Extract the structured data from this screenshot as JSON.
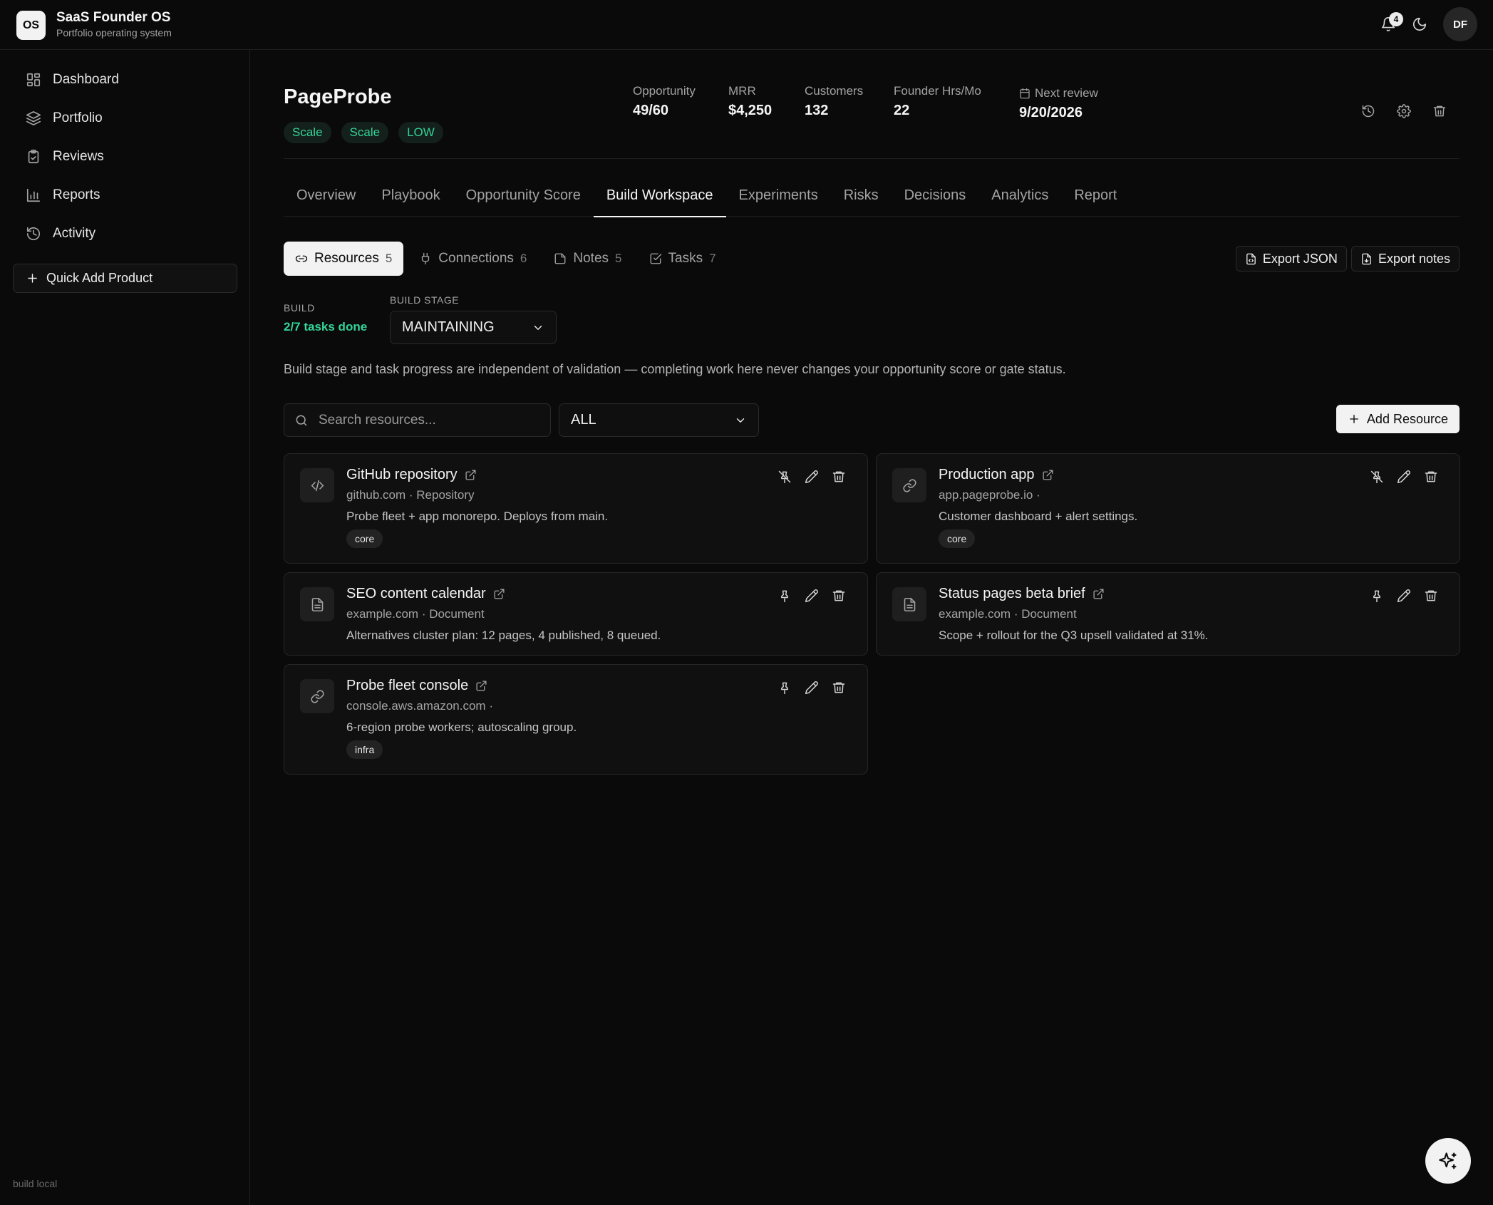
{
  "app": {
    "logo": "OS",
    "title": "SaaS Founder OS",
    "subtitle": "Portfolio operating system",
    "notification_count": "4",
    "avatar_initials": "DF"
  },
  "sidebar": {
    "items": [
      {
        "label": "Dashboard",
        "icon": "dashboard-icon"
      },
      {
        "label": "Portfolio",
        "icon": "layers-icon"
      },
      {
        "label": "Reviews",
        "icon": "clipboard-icon"
      },
      {
        "label": "Reports",
        "icon": "bar-chart-icon"
      },
      {
        "label": "Activity",
        "icon": "history-icon"
      }
    ],
    "quick_add": "Quick Add Product",
    "footer": "build local"
  },
  "product": {
    "name": "PageProbe",
    "pills": [
      "Scale",
      "Scale",
      "LOW"
    ],
    "stats": [
      {
        "label": "Opportunity",
        "value": "49/60"
      },
      {
        "label": "MRR",
        "value": "$4,250"
      },
      {
        "label": "Customers",
        "value": "132"
      },
      {
        "label": "Founder Hrs/Mo",
        "value": "22"
      },
      {
        "label": "Next review",
        "value": "9/20/2026"
      }
    ]
  },
  "tabs": [
    "Overview",
    "Playbook",
    "Opportunity Score",
    "Build Workspace",
    "Experiments",
    "Risks",
    "Decisions",
    "Analytics",
    "Report"
  ],
  "active_tab": "Build Workspace",
  "subtabs": [
    {
      "label": "Resources",
      "count": "5"
    },
    {
      "label": "Connections",
      "count": "6"
    },
    {
      "label": "Notes",
      "count": "5"
    },
    {
      "label": "Tasks",
      "count": "7"
    }
  ],
  "export": {
    "json": "Export JSON",
    "notes": "Export notes"
  },
  "build": {
    "label": "BUILD",
    "value": "2/7 tasks done",
    "stage_label": "BUILD STAGE",
    "stage_value": "MAINTAINING"
  },
  "info_text": "Build stage and task progress are independent of validation — completing work here never changes your opportunity score or gate status.",
  "search": {
    "placeholder": "Search resources..."
  },
  "filter": {
    "value": "ALL"
  },
  "add_resource": "Add Resource",
  "resources": [
    {
      "title": "GitHub repository",
      "meta": "github.com · Repository",
      "desc": "Probe fleet + app monorepo. Deploys from main.",
      "tag": "core",
      "icon": "code-icon",
      "pinned": true
    },
    {
      "title": "Production app",
      "meta": "app.pageprobe.io ·",
      "desc": "Customer dashboard + alert settings.",
      "tag": "core",
      "icon": "link-icon",
      "pinned": true
    },
    {
      "title": "SEO content calendar",
      "meta": "example.com · Document",
      "desc": "Alternatives cluster plan: 12 pages, 4 published, 8 queued.",
      "tag": "",
      "icon": "document-icon",
      "pinned": false
    },
    {
      "title": "Status pages beta brief",
      "meta": "example.com · Document",
      "desc": "Scope + rollout for the Q3 upsell validated at 31%.",
      "tag": "",
      "icon": "document-icon",
      "pinned": false
    },
    {
      "title": "Probe fleet console",
      "meta": "console.aws.amazon.com ·",
      "desc": "6-region probe workers; autoscaling group.",
      "tag": "infra",
      "icon": "link-icon",
      "pinned": false
    }
  ]
}
